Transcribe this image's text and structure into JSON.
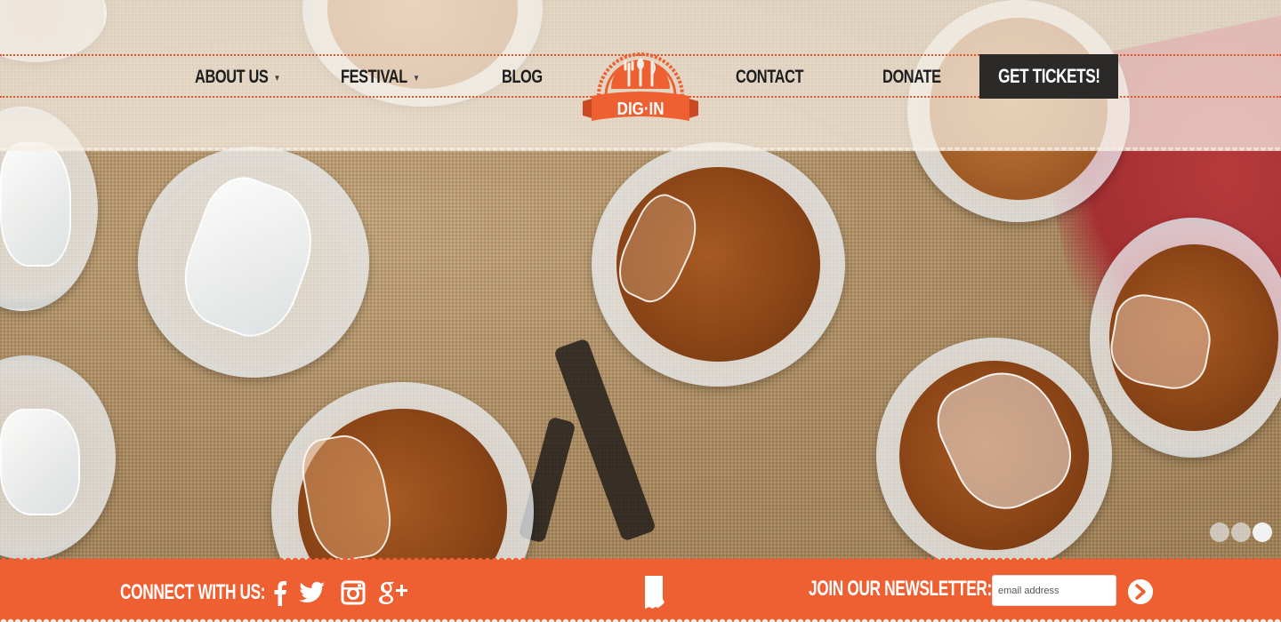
{
  "header": {
    "logo_text": "DIG·IN",
    "nav_left": [
      {
        "label": "ABOUT US",
        "has_dropdown": true
      },
      {
        "label": "FESTIVAL",
        "has_dropdown": true
      },
      {
        "label": "BLOG",
        "has_dropdown": false
      }
    ],
    "nav_right": [
      {
        "label": "CONTACT"
      },
      {
        "label": "DONATE"
      }
    ],
    "cta_label": "GET TICKETS!"
  },
  "hero": {
    "slides_count": 3,
    "active_slide": 3
  },
  "footer": {
    "connect_label": "CONNECT WITH US:",
    "social_icons": [
      "facebook-icon",
      "twitter-icon",
      "instagram-icon",
      "google-plus-icon"
    ],
    "state_icon": "indiana-icon",
    "newsletter_label": "JOIN OUR NEWSLETTER:",
    "email_placeholder": "email address",
    "submit_icon": "arrow-right-icon"
  },
  "colors": {
    "brand_orange": "#ee5f32",
    "cta_dark": "#2b2a29",
    "nav_text": "#1d1d1d"
  }
}
